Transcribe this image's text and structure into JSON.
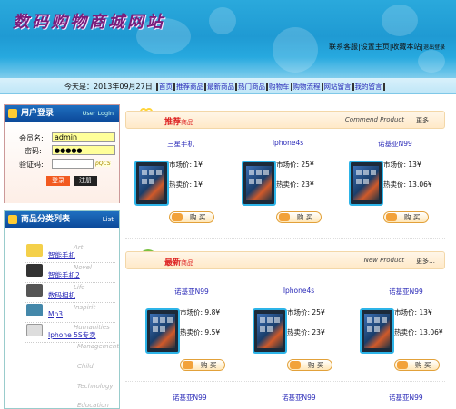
{
  "header": {
    "logo": "数码购物商城网站",
    "links": [
      "联系客服",
      "设置主页",
      "收藏本站"
    ],
    "exit": "退出登录"
  },
  "nav": {
    "today": "今天是：2013年09月27日",
    "items": [
      "首页",
      "推荐商品",
      "最新商品",
      "热门商品",
      "购物车",
      "购物流程",
      "网站留言",
      "我的留言"
    ]
  },
  "login": {
    "title": "用户登录",
    "title_en": "User Login",
    "username_label": "会员名:",
    "username_value": "admin",
    "password_label": "密码:",
    "password_value": "●●●●●",
    "captcha_label": "验证码:",
    "captcha_code": "pQCS",
    "login_btn": "登录",
    "register_btn": "注册"
  },
  "categories": {
    "title": "商品分类列表",
    "title_en": "List",
    "items": [
      {
        "name": "智能手机",
        "en": "Art"
      },
      {
        "name": "智能手机2",
        "en": "Novel"
      },
      {
        "name": "数码相机",
        "en": "Life"
      },
      {
        "name": "Mp3",
        "en": "Inspirit"
      },
      {
        "name": "Iphone 5S专卖",
        "en": "Humanities"
      }
    ],
    "extra_en": [
      "Management",
      "Child",
      "Technology",
      "Education"
    ]
  },
  "recommended": {
    "title": "推荐",
    "title_small": "商品",
    "title_en": "Commend Product",
    "more": "更多…",
    "products": [
      {
        "name": "三星手机",
        "market": "市场价:  1¥",
        "hot": "热卖价:  1¥",
        "buy": "购 买"
      },
      {
        "name": "Iphone4s",
        "market": "市场价:  25¥",
        "hot": "热卖价:  23¥",
        "buy": "购 买"
      },
      {
        "name": "诺基亚N99",
        "market": "市场价:  13¥",
        "hot": "热卖价:  13.06¥",
        "buy": "购 买"
      }
    ]
  },
  "newest": {
    "title": "最新",
    "title_small": "商品",
    "title_en": "New Product",
    "more": "更多…",
    "products": [
      {
        "name": "诺基亚N99",
        "market": "市场价:  9.8¥",
        "hot": "热卖价:  9.5¥",
        "buy": "购 买"
      },
      {
        "name": "Iphone4s",
        "market": "市场价:  25¥",
        "hot": "热卖价:  23¥",
        "buy": "购 买"
      },
      {
        "name": "诺基亚N99",
        "market": "市场价:  13¥",
        "hot": "热卖价:  13.06¥",
        "buy": "购 买"
      }
    ],
    "next_row": [
      "诺基亚N99",
      "诺基亚N99",
      "诺基亚N99"
    ]
  },
  "colors": {
    "header": "#1f9ad3",
    "logo": "#7a1c7a",
    "link": "#2a2ab8",
    "accent": "#d22"
  }
}
